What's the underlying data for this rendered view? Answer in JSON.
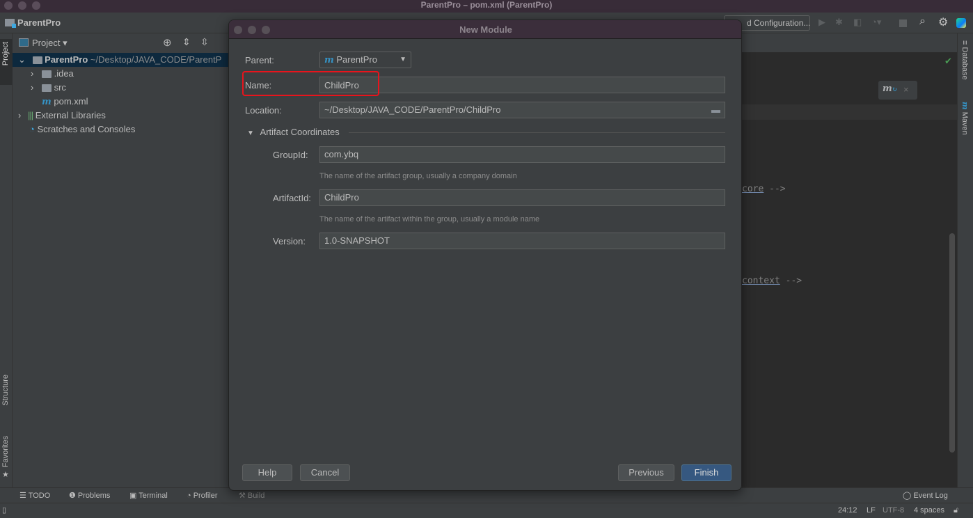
{
  "window": {
    "title": "ParentPro – pom.xml (ParentPro)"
  },
  "navbar": {
    "project_name": "ParentPro",
    "run_config": "d Configuration..."
  },
  "left_stripe": {
    "project": "Project",
    "structure": "Structure",
    "favorites": "Favorites"
  },
  "project_panel": {
    "header": "Project",
    "tree": [
      {
        "label": "ParentPro",
        "path": "~/Desktop/JAVA_CODE/ParentP",
        "icon": "module-folder-icon"
      },
      {
        "label": ".idea",
        "icon": "folder-icon"
      },
      {
        "label": "src",
        "icon": "folder-icon"
      },
      {
        "label": "pom.xml",
        "icon": "maven-icon"
      },
      {
        "label": "External Libraries",
        "icon": "libraries-icon"
      },
      {
        "label": "Scratches and Consoles",
        "icon": "scratches-icon"
      }
    ]
  },
  "editor": {
    "line1_word": "core",
    "line1_tail": " -->",
    "line2_word": "context",
    "line2_tail": " -->"
  },
  "right_stripe": {
    "database": "Database",
    "maven": "Maven"
  },
  "dialog": {
    "title": "New Module",
    "parent_label": "Parent:",
    "parent_value": "ParentPro",
    "name_label": "Name:",
    "name_value": "ChildPro",
    "location_label": "Location:",
    "location_value": "~/Desktop/JAVA_CODE/ParentPro/ChildPro",
    "artifact_section": "Artifact Coordinates",
    "groupid_label": "GroupId:",
    "groupid_value": "com.ybq",
    "groupid_hint": "The name of the artifact group, usually a company domain",
    "artifactid_label": "ArtifactId:",
    "artifactid_value": "ChildPro",
    "artifactid_hint": "The name of the artifact within the group, usually a module name",
    "version_label": "Version:",
    "version_value": "1.0-SNAPSHOT",
    "help": "Help",
    "cancel": "Cancel",
    "previous": "Previous",
    "finish": "Finish",
    "highlight_color": "#e8141c"
  },
  "bottom_tools": {
    "todo": "TODO",
    "problems": "Problems",
    "terminal": "Terminal",
    "profiler": "Profiler",
    "build": "Build",
    "event_log": "Event Log"
  },
  "status": {
    "position": "24:12",
    "line_sep": "LF",
    "encoding": "UTF-8",
    "indent": "4 spaces"
  }
}
